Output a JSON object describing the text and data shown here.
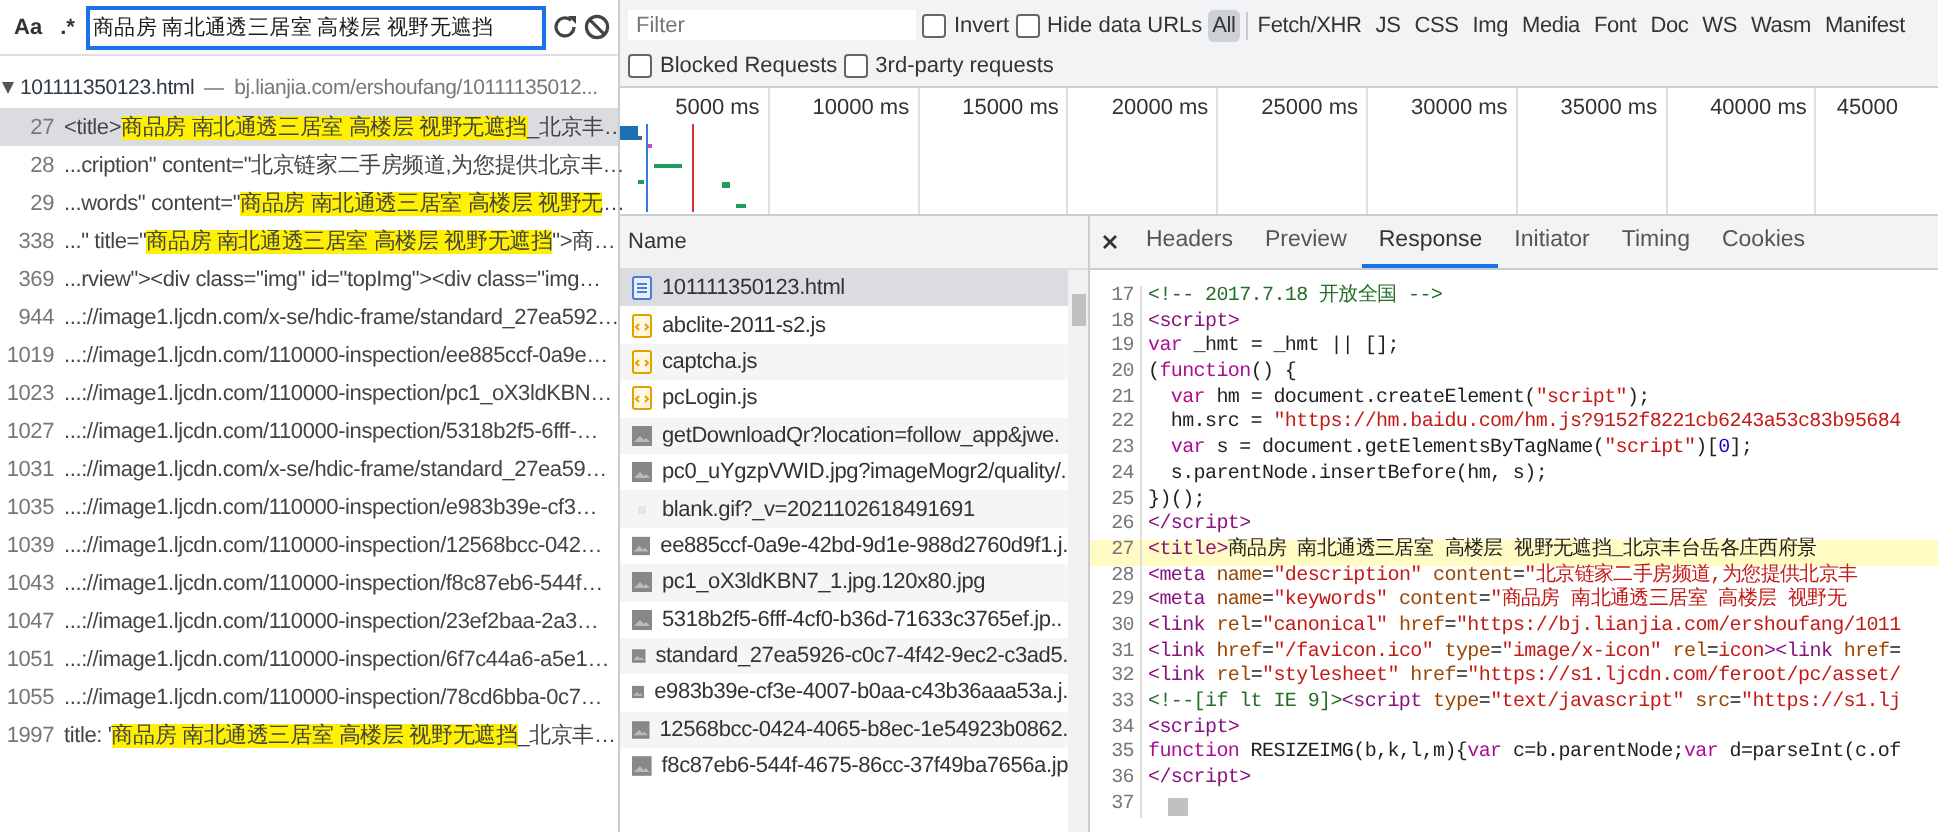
{
  "search_panel": {
    "case_button": "Aa",
    "regex_button": ".*",
    "query": "商品房 南北通透三居室 高楼层 视野无遮挡",
    "file": {
      "name": "101111350123.html",
      "url": "bj.lianjia.com/ershoufang/10111135012...",
      "expanded": true
    },
    "results": [
      {
        "line": "27",
        "before": "<title>",
        "match": "商品房 南北通透三居室 高楼层 视野无遮挡",
        "after": "_北京丰…",
        "selected": true
      },
      {
        "line": "28",
        "before": "...cription\" content=\"北京链家二手房频道,为您提供北京丰…",
        "selected": false
      },
      {
        "line": "29",
        "before": "...words\" content=\"",
        "match": "商品房 南北通透三居室 高楼层 视野无",
        "after": "…",
        "selected": false
      },
      {
        "line": "338",
        "before": "...\" title=\"",
        "match": "商品房 南北通透三居室 高楼层 视野无遮挡",
        "after": "\">商…",
        "selected": false
      },
      {
        "line": "369",
        "before": "...rview\"><div class=\"img\" id=\"topImg\"><div class=\"img…",
        "selected": false
      },
      {
        "line": "944",
        "before": "...://image1.ljcdn.com/x-se/hdic-frame/standard_27ea592…",
        "selected": false
      },
      {
        "line": "1019",
        "before": "...://image1.ljcdn.com/110000-inspection/ee885ccf-0a9e…",
        "selected": false
      },
      {
        "line": "1023",
        "before": "...://image1.ljcdn.com/110000-inspection/pc1_oX3ldKBN…",
        "selected": false
      },
      {
        "line": "1027",
        "before": "...://image1.ljcdn.com/110000-inspection/5318b2f5-6fff-…",
        "selected": false
      },
      {
        "line": "1031",
        "before": "...://image1.ljcdn.com/x-se/hdic-frame/standard_27ea59…",
        "selected": false
      },
      {
        "line": "1035",
        "before": "...://image1.ljcdn.com/110000-inspection/e983b39e-cf3…",
        "selected": false
      },
      {
        "line": "1039",
        "before": "...://image1.ljcdn.com/110000-inspection/12568bcc-042…",
        "selected": false
      },
      {
        "line": "1043",
        "before": "...://image1.ljcdn.com/110000-inspection/f8c87eb6-544f…",
        "selected": false
      },
      {
        "line": "1047",
        "before": "...://image1.ljcdn.com/110000-inspection/23ef2baa-2a3…",
        "selected": false
      },
      {
        "line": "1051",
        "before": "...://image1.ljcdn.com/110000-inspection/6f7c44a6-a5e1…",
        "selected": false
      },
      {
        "line": "1055",
        "before": "...://image1.ljcdn.com/110000-inspection/78cd6bba-0c7…",
        "selected": false
      },
      {
        "line": "1997",
        "before": "title: '",
        "match": "商品房 南北通透三居室 高楼层 视野无遮挡",
        "after": "_北京丰…",
        "selected": false
      }
    ]
  },
  "filter_bar": {
    "placeholder": "Filter",
    "checkboxes": [
      {
        "label": "Invert",
        "checked": false
      },
      {
        "label": "Hide data URLs",
        "checked": false
      },
      {
        "label": "Blocked Requests",
        "checked": false
      },
      {
        "label": "3rd-party requests",
        "checked": false
      }
    ],
    "types": [
      {
        "label": "All",
        "selected": true
      },
      {
        "label": "Fetch/XHR",
        "selected": false
      },
      {
        "label": "JS",
        "selected": false
      },
      {
        "label": "CSS",
        "selected": false
      },
      {
        "label": "Img",
        "selected": false
      },
      {
        "label": "Media",
        "selected": false
      },
      {
        "label": "Font",
        "selected": false
      },
      {
        "label": "Doc",
        "selected": false
      },
      {
        "label": "WS",
        "selected": false
      },
      {
        "label": "Wasm",
        "selected": false
      },
      {
        "label": "Manifest",
        "selected": false
      }
    ]
  },
  "timeline": {
    "ticks": [
      "5000 ms",
      "10000 ms",
      "15000 ms",
      "20000 ms",
      "25000 ms",
      "30000 ms",
      "35000 ms",
      "40000 ms",
      "45000"
    ]
  },
  "requests": {
    "column": "Name",
    "rows": [
      {
        "name": "101111350123.html",
        "kind": "doc",
        "selected": true
      },
      {
        "name": "abclite-2011-s2.js",
        "kind": "script",
        "selected": false
      },
      {
        "name": "captcha.js",
        "kind": "script",
        "selected": false
      },
      {
        "name": "pcLogin.js",
        "kind": "script",
        "selected": false
      },
      {
        "name": "getDownloadQr?location=follow_app&jwe.",
        "kind": "image",
        "selected": false
      },
      {
        "name": "pc0_uYgzpVWID.jpg?imageMogr2/quality/.",
        "kind": "image",
        "selected": false
      },
      {
        "name": "blank.gif?_v=2021102618491691",
        "kind": "blank",
        "selected": false
      },
      {
        "name": "ee885ccf-0a9e-42bd-9d1e-988d2760d9f1.j.",
        "kind": "image",
        "selected": false
      },
      {
        "name": "pc1_oX3ldKBN7_1.jpg.120x80.jpg",
        "kind": "image",
        "selected": false
      },
      {
        "name": "5318b2f5-6fff-4cf0-b36d-71633c3765ef.jp..",
        "kind": "image",
        "selected": false
      },
      {
        "name": "standard_27ea5926-c0c7-4f42-9ec2-c3ad5.",
        "kind": "image",
        "selected": false
      },
      {
        "name": "e983b39e-cf3e-4007-b0aa-c43b36aaa53a.j.",
        "kind": "image",
        "selected": false
      },
      {
        "name": "12568bcc-0424-4065-b8ec-1e54923b0862.",
        "kind": "image",
        "selected": false
      },
      {
        "name": "f8c87eb6-544f-4675-86cc-37f49ba7656a.jp",
        "kind": "image",
        "selected": false
      }
    ]
  },
  "detail": {
    "tabs": [
      {
        "label": "Headers",
        "selected": false
      },
      {
        "label": "Preview",
        "selected": false
      },
      {
        "label": "Response",
        "selected": true
      },
      {
        "label": "Initiator",
        "selected": false
      },
      {
        "label": "Timing",
        "selected": false
      },
      {
        "label": "Cookies",
        "selected": false
      }
    ],
    "lines": [
      {
        "number": "17",
        "highlighted": false,
        "tokens": [
          {
            "kind": "comment",
            "text": "<!-- 2017.7.18 开放全国 -->"
          }
        ]
      },
      {
        "number": "18",
        "highlighted": false,
        "tokens": [
          {
            "kind": "tag",
            "text": "<script>"
          }
        ]
      },
      {
        "number": "19",
        "highlighted": false,
        "tokens": [
          {
            "kind": "keyword",
            "text": "var"
          },
          {
            "kind": "plain",
            "text": " _hmt = _hmt || [];"
          }
        ]
      },
      {
        "number": "20",
        "highlighted": false,
        "tokens": [
          {
            "kind": "plain",
            "text": "("
          },
          {
            "kind": "keyword",
            "text": "function"
          },
          {
            "kind": "plain",
            "text": "() {"
          }
        ]
      },
      {
        "number": "21",
        "highlighted": false,
        "tokens": [
          {
            "kind": "keyword",
            "text": "  var"
          },
          {
            "kind": "plain",
            "text": " hm = document.createElement("
          },
          {
            "kind": "string",
            "text": "\"script\""
          },
          {
            "kind": "plain",
            "text": ");"
          }
        ]
      },
      {
        "number": "22",
        "highlighted": false,
        "tokens": [
          {
            "kind": "plain",
            "text": "  hm.src = "
          },
          {
            "kind": "string",
            "text": "\"https://hm.baidu.com/hm.js?9152f8221cb6243a53c83b95684"
          }
        ]
      },
      {
        "number": "23",
        "highlighted": false,
        "tokens": [
          {
            "kind": "keyword",
            "text": "  var"
          },
          {
            "kind": "plain",
            "text": " s = document.getElementsByTagName("
          },
          {
            "kind": "string",
            "text": "\"script\""
          },
          {
            "kind": "plain",
            "text": ")["
          },
          {
            "kind": "number",
            "text": "0"
          },
          {
            "kind": "plain",
            "text": "];"
          }
        ]
      },
      {
        "number": "24",
        "highlighted": false,
        "tokens": [
          {
            "kind": "plain",
            "text": "  s.parentNode.insertBefore(hm, s);"
          }
        ]
      },
      {
        "number": "25",
        "highlighted": false,
        "tokens": [
          {
            "kind": "plain",
            "text": "})();"
          }
        ]
      },
      {
        "number": "26",
        "highlighted": false,
        "tokens": [
          {
            "kind": "tag",
            "text": "</script>"
          }
        ]
      },
      {
        "number": "27",
        "highlighted": true,
        "tokens": [
          {
            "kind": "tag",
            "text": "<title>"
          },
          {
            "kind": "plain",
            "text": "商品房 南北通透三居室 高楼层 视野无遮挡_北京丰台岳各庄西府景"
          }
        ]
      },
      {
        "number": "28",
        "highlighted": false,
        "tokens": [
          {
            "kind": "tag",
            "text": "<meta"
          },
          {
            "kind": "attr",
            "text": " name"
          },
          {
            "kind": "plain",
            "text": "="
          },
          {
            "kind": "string",
            "text": "\"description\""
          },
          {
            "kind": "attr",
            "text": " content"
          },
          {
            "kind": "plain",
            "text": "="
          },
          {
            "kind": "string",
            "text": "\"北京链家二手房频道,为您提供北京丰"
          }
        ]
      },
      {
        "number": "29",
        "highlighted": false,
        "tokens": [
          {
            "kind": "tag",
            "text": "<meta"
          },
          {
            "kind": "attr",
            "text": " name"
          },
          {
            "kind": "plain",
            "text": "="
          },
          {
            "kind": "string",
            "text": "\"keywords\""
          },
          {
            "kind": "attr",
            "text": " content"
          },
          {
            "kind": "plain",
            "text": "="
          },
          {
            "kind": "string",
            "text": "\"商品房 南北通透三居室 高楼层 视野无"
          }
        ]
      },
      {
        "number": "30",
        "highlighted": false,
        "tokens": [
          {
            "kind": "tag",
            "text": "<link"
          },
          {
            "kind": "attr",
            "text": " rel"
          },
          {
            "kind": "plain",
            "text": "="
          },
          {
            "kind": "string",
            "text": "\"canonical\""
          },
          {
            "kind": "attr",
            "text": " href"
          },
          {
            "kind": "plain",
            "text": "="
          },
          {
            "kind": "string",
            "text": "\"https://bj.lianjia.com/ershoufang/1011"
          }
        ]
      },
      {
        "number": "31",
        "highlighted": false,
        "tokens": [
          {
            "kind": "tag",
            "text": "<link"
          },
          {
            "kind": "attr",
            "text": " href"
          },
          {
            "kind": "plain",
            "text": "="
          },
          {
            "kind": "string",
            "text": "\"/favicon.ico\""
          },
          {
            "kind": "attr",
            "text": " type"
          },
          {
            "kind": "plain",
            "text": "="
          },
          {
            "kind": "string",
            "text": "\"image/x-icon\""
          },
          {
            "kind": "attr",
            "text": " rel"
          },
          {
            "kind": "plain",
            "text": "="
          },
          {
            "kind": "string",
            "text": "icon"
          },
          {
            "kind": "tag",
            "text": "><link"
          },
          {
            "kind": "attr",
            "text": " href"
          },
          {
            "kind": "plain",
            "text": "="
          }
        ]
      },
      {
        "number": "32",
        "highlighted": false,
        "tokens": [
          {
            "kind": "tag",
            "text": "<link"
          },
          {
            "kind": "attr",
            "text": " rel"
          },
          {
            "kind": "plain",
            "text": "="
          },
          {
            "kind": "string",
            "text": "\"stylesheet\""
          },
          {
            "kind": "attr",
            "text": " href"
          },
          {
            "kind": "plain",
            "text": "="
          },
          {
            "kind": "string",
            "text": "\"https://s1.ljcdn.com/feroot/pc/asset/"
          }
        ]
      },
      {
        "number": "33",
        "highlighted": false,
        "tokens": [
          {
            "kind": "comment",
            "text": "<!--[if lt IE 9]>"
          },
          {
            "kind": "tag",
            "text": "<script"
          },
          {
            "kind": "attr",
            "text": " type"
          },
          {
            "kind": "plain",
            "text": "="
          },
          {
            "kind": "string",
            "text": "\"text/javascript\""
          },
          {
            "kind": "attr",
            "text": " src"
          },
          {
            "kind": "plain",
            "text": "="
          },
          {
            "kind": "string",
            "text": "\"https://s1.lj"
          }
        ]
      },
      {
        "number": "34",
        "highlighted": false,
        "tokens": [
          {
            "kind": "tag",
            "text": "<script>"
          }
        ]
      },
      {
        "number": "35",
        "highlighted": false,
        "tokens": [
          {
            "kind": "keyword",
            "text": "function"
          },
          {
            "kind": "plain",
            "text": " RESIZEIMG(b,k,l,m){"
          },
          {
            "kind": "keyword",
            "text": "var"
          },
          {
            "kind": "plain",
            "text": " c=b.parentNode;"
          },
          {
            "kind": "keyword",
            "text": "var"
          },
          {
            "kind": "plain",
            "text": " d=parseInt(c.of"
          }
        ]
      },
      {
        "number": "36",
        "highlighted": false,
        "tokens": [
          {
            "kind": "tag",
            "text": "</script>"
          }
        ]
      },
      {
        "number": "37",
        "highlighted": false
      }
    ]
  }
}
